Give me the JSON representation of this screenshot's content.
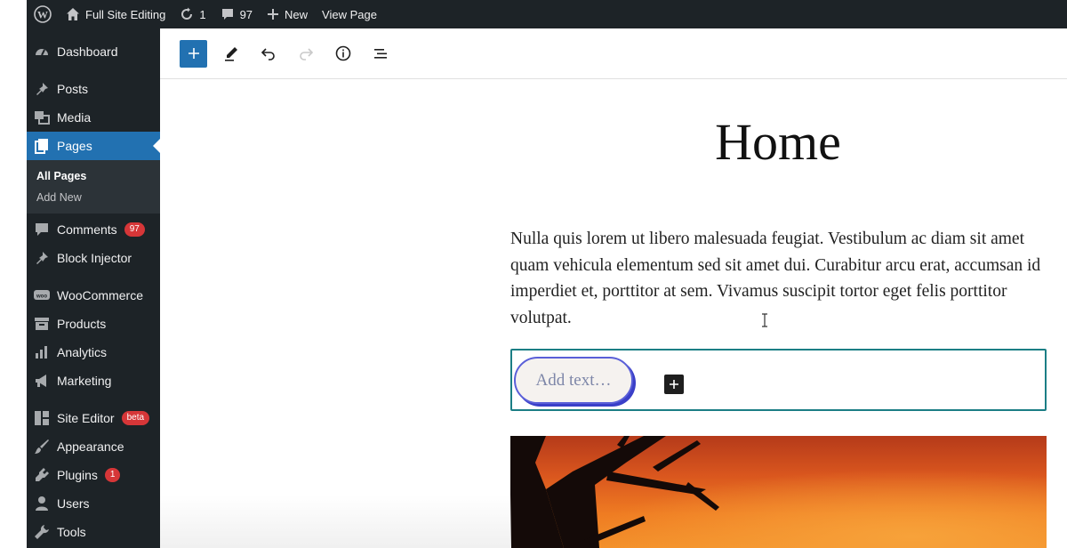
{
  "adminbar": {
    "site_name": "Full Site Editing",
    "updates_count": "1",
    "comments_count": "97",
    "new_label": "New",
    "view_page_label": "View Page"
  },
  "sidebar": {
    "items": [
      {
        "label": "Dashboard",
        "icon": "dashboard-icon"
      },
      {
        "label": "Posts",
        "icon": "pin-icon"
      },
      {
        "label": "Media",
        "icon": "media-icon"
      },
      {
        "label": "Pages",
        "icon": "pages-icon",
        "active": true
      },
      {
        "label": "Comments",
        "icon": "comment-icon",
        "badge": "97"
      },
      {
        "label": "Block Injector",
        "icon": "pin-icon"
      },
      {
        "label": "WooCommerce",
        "icon": "woocommerce-icon"
      },
      {
        "label": "Products",
        "icon": "archive-icon"
      },
      {
        "label": "Analytics",
        "icon": "bar-chart-icon"
      },
      {
        "label": "Marketing",
        "icon": "megaphone-icon"
      },
      {
        "label": "Site Editor",
        "icon": "layout-icon",
        "badge": "beta"
      },
      {
        "label": "Appearance",
        "icon": "brush-icon"
      },
      {
        "label": "Plugins",
        "icon": "plug-icon",
        "badge": "1"
      },
      {
        "label": "Users",
        "icon": "user-icon"
      },
      {
        "label": "Tools",
        "icon": "wrench-icon"
      }
    ],
    "submenu": [
      {
        "label": "All Pages",
        "current": true
      },
      {
        "label": "Add New"
      }
    ]
  },
  "editor": {
    "title": "Home",
    "paragraph": "Nulla quis lorem ut libero malesuada feugiat. Vestibulum ac diam sit amet quam vehicula elementum sed sit amet dui. Curabitur arcu erat, accumsan id imperdiet et, porttitor at sem. Vivamus suscipit tortor eget felis porttitor volutpat.",
    "button_placeholder": "Add text…"
  },
  "colors": {
    "admin_bg": "#1d2327",
    "accent": "#2271b1",
    "badge": "#d63638",
    "selection_border": "#1b7e85"
  }
}
